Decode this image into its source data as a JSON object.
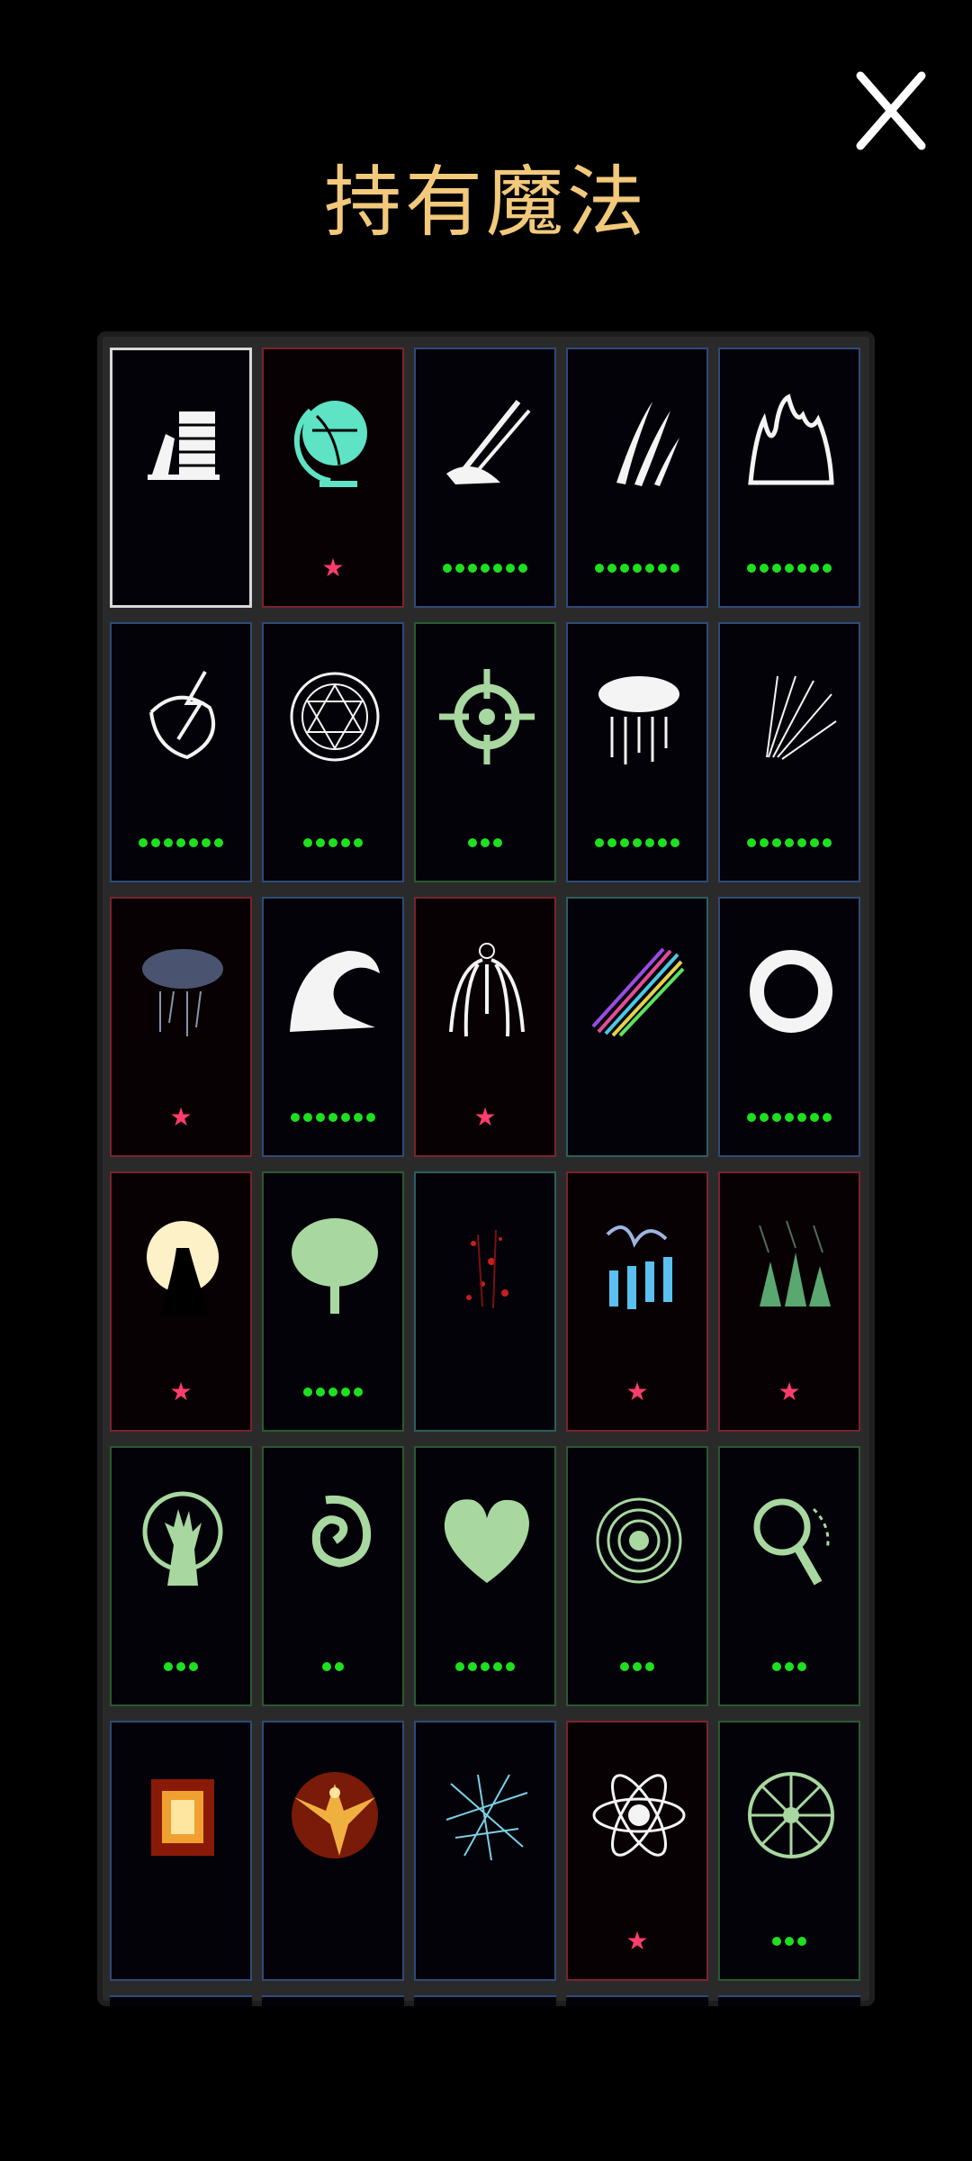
{
  "screen": {
    "title": "持有魔法",
    "close_label": "X"
  },
  "colors": {
    "title": "#f2c97b",
    "rank_dot": "#1ee01e",
    "star": "#ff3d6b",
    "border_blue": "#2f4a78",
    "border_red": "#7a2330",
    "border_green": "#2a5a30",
    "border_white": "#d8d8d8"
  },
  "spells": [
    {
      "icon": "book-stack-icon",
      "border": "white",
      "marker": "none",
      "rank": 0
    },
    {
      "icon": "globe-icon",
      "border": "red",
      "marker": "star",
      "rank": 0
    },
    {
      "icon": "sword-slash-icon",
      "border": "blue",
      "marker": "dots",
      "rank": 7
    },
    {
      "icon": "claw-slash-icon",
      "border": "blue",
      "marker": "dots",
      "rank": 7
    },
    {
      "icon": "flame-icon",
      "border": "blue",
      "marker": "dots",
      "rank": 7
    },
    {
      "icon": "lightning-orb-icon",
      "border": "blue",
      "marker": "dots",
      "rank": 7
    },
    {
      "icon": "magic-circle-icon",
      "border": "blue",
      "marker": "dots",
      "rank": 5
    },
    {
      "icon": "crosshair-icon",
      "border": "green",
      "marker": "dots",
      "rank": 3
    },
    {
      "icon": "rain-cloud-icon",
      "border": "blue",
      "marker": "dots",
      "rank": 7
    },
    {
      "icon": "light-rays-icon",
      "border": "blue",
      "marker": "dots",
      "rank": 7
    },
    {
      "icon": "storm-cloud-icon",
      "border": "red",
      "marker": "star",
      "rank": 0
    },
    {
      "icon": "wave-icon",
      "border": "blue",
      "marker": "dots",
      "rank": 7
    },
    {
      "icon": "angel-wings-icon",
      "border": "red",
      "marker": "star",
      "rank": 0
    },
    {
      "icon": "rainbow-beam-icon",
      "border": "teal",
      "marker": "none",
      "rank": 0
    },
    {
      "icon": "ring-icon",
      "border": "blue",
      "marker": "dots",
      "rank": 7
    },
    {
      "icon": "moon-silhouette-icon",
      "border": "red",
      "marker": "star",
      "rank": 0
    },
    {
      "icon": "tree-icon",
      "border": "green",
      "marker": "dots",
      "rank": 5
    },
    {
      "icon": "red-sparks-icon",
      "border": "teal",
      "marker": "none",
      "rank": 0
    },
    {
      "icon": "ice-pillars-icon",
      "border": "red",
      "marker": "star",
      "rank": 0
    },
    {
      "icon": "forest-rain-icon",
      "border": "red",
      "marker": "star",
      "rank": 0
    },
    {
      "icon": "rising-hand-icon",
      "border": "green",
      "marker": "dots",
      "rank": 3
    },
    {
      "icon": "spiral-icon",
      "border": "green",
      "marker": "dots",
      "rank": 2
    },
    {
      "icon": "heart-icon",
      "border": "green",
      "marker": "dots",
      "rank": 5
    },
    {
      "icon": "vortex-icon",
      "border": "green",
      "marker": "dots",
      "rank": 3
    },
    {
      "icon": "magnifier-icon",
      "border": "green",
      "marker": "dots",
      "rank": 3
    },
    {
      "icon": "fire-portal-icon",
      "border": "blue",
      "marker": "none",
      "rank": 0
    },
    {
      "icon": "phoenix-icon",
      "border": "blue",
      "marker": "none",
      "rank": 0
    },
    {
      "icon": "blue-web-icon",
      "border": "blue",
      "marker": "none",
      "rank": 0
    },
    {
      "icon": "atom-icon",
      "border": "red",
      "marker": "star",
      "rank": 0
    },
    {
      "icon": "wheel-icon",
      "border": "green",
      "marker": "dots",
      "rank": 3
    }
  ]
}
